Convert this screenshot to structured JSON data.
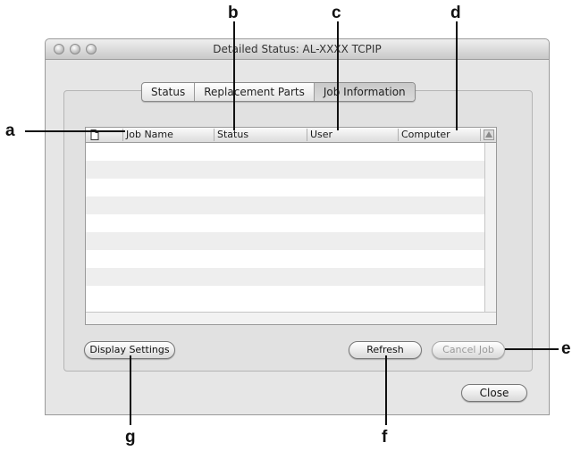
{
  "window": {
    "title": "Detailed Status: AL-XXXX  TCPIP"
  },
  "tabs": [
    {
      "label": "Status"
    },
    {
      "label": "Replacement Parts"
    },
    {
      "label": "Job Information",
      "active": true
    }
  ],
  "table": {
    "columns": [
      {
        "label": ""
      },
      {
        "label": "Job Name"
      },
      {
        "label": "Status"
      },
      {
        "label": "User"
      },
      {
        "label": "Computer"
      }
    ],
    "rows": [
      [],
      [],
      [],
      [],
      [],
      [],
      [],
      [],
      []
    ]
  },
  "buttons": {
    "display_settings": "Display Settings",
    "refresh": "Refresh",
    "cancel_job": "Cancel Job",
    "close": "Close"
  },
  "callouts": [
    "a",
    "b",
    "c",
    "d",
    "e",
    "f",
    "g"
  ]
}
